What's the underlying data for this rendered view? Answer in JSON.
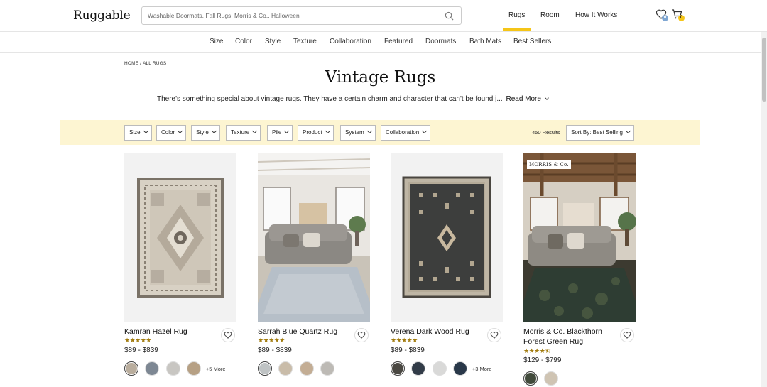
{
  "header": {
    "logo": "Ruggable",
    "search_placeholder": "Washable Doormats, Fall Rugs, Morris & Co., Halloween",
    "nav": [
      "Rugs",
      "Room",
      "How It Works"
    ],
    "wishlist_count": "0",
    "cart_count": "0"
  },
  "categories": [
    "Size",
    "Color",
    "Style",
    "Texture",
    "Collaboration",
    "Featured",
    "Doormats",
    "Bath Mats",
    "Best Sellers"
  ],
  "breadcrumb": "HOME / ALL RUGS",
  "page": {
    "title": "Vintage Rugs",
    "description": "There's something special about vintage rugs. They have a certain charm and character that can't be found j...",
    "read_more": "Read More"
  },
  "filters": [
    "Size",
    "Color",
    "Style",
    "Texture",
    "Pile",
    "Product",
    "System",
    "Collaboration"
  ],
  "results_label": "450 Results",
  "sort_label": "Sort By: Best Selling",
  "products": [
    {
      "name": "Kamran Hazel Rug",
      "stars": "★★★★★",
      "rating": 5,
      "price": "$89 - $839",
      "more_label": "+5 More",
      "swatch_colors": [
        "#b9ad9d",
        "#7d8793",
        "#c8c6c2",
        "#b6a084"
      ]
    },
    {
      "name": "Sarrah Blue Quartz Rug",
      "stars": "★★★★★",
      "rating": 5,
      "price": "$89 - $839",
      "more_label": "",
      "swatch_colors": [
        "#bfc3c4",
        "#c9bca9",
        "#c3ad94",
        "#bdbab5"
      ]
    },
    {
      "name": "Verena Dark Wood Rug",
      "stars": "★★★★★",
      "rating": 5,
      "price": "$89 - $839",
      "more_label": "+3 More",
      "swatch_colors": [
        "#4a4842",
        "#323c48",
        "#d9d9d8",
        "#293849"
      ]
    },
    {
      "name": "Morris & Co. Blackthorn Forest Green Rug",
      "stars": "★★★★⯪",
      "rating": 4.5,
      "price": "$129 - $799",
      "more_label": "",
      "brand_badge": "MORRIS & Co.",
      "swatch_colors": [
        "#414a3b",
        "#cfc4b3"
      ]
    }
  ],
  "colors": {
    "accent": "#f5c518",
    "filter_bar_bg": "#fdf5d2",
    "star": "#a27c0f"
  }
}
